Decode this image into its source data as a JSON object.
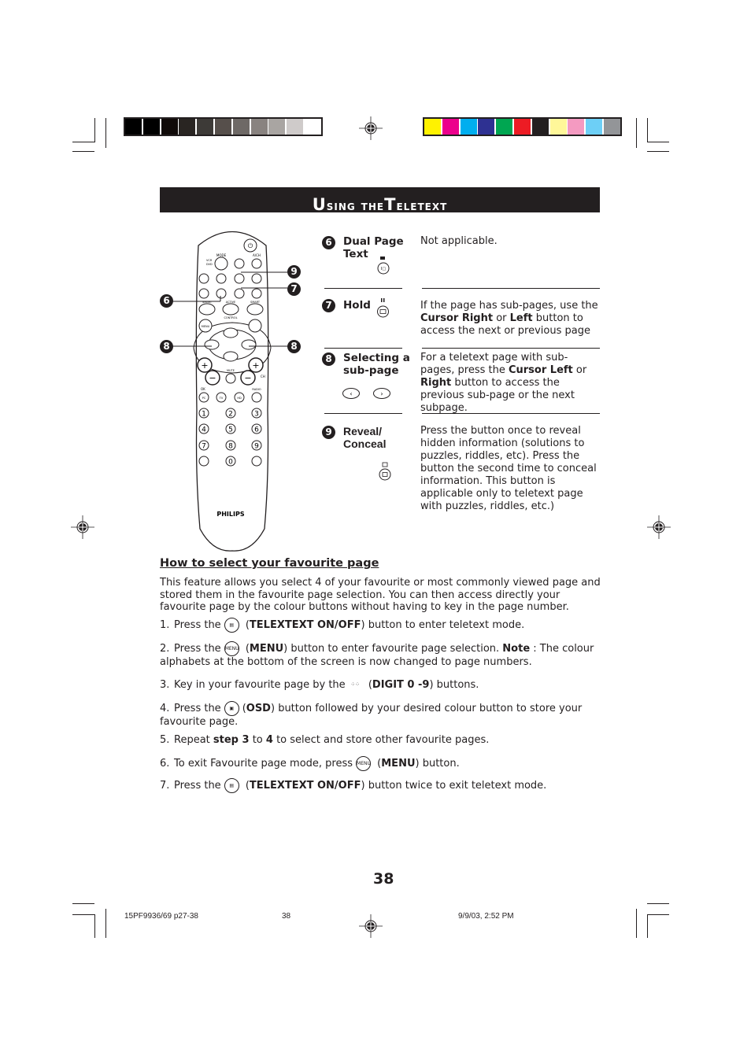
{
  "title": {
    "first_big": "U",
    "first_rest": "sing the ",
    "second_big": "T",
    "second_rest": "eletext"
  },
  "color_bars": {
    "grayscale": [
      "#000000",
      "#000000",
      "#100a08",
      "#292522",
      "#3d3a37",
      "#564f4b",
      "#6e6966",
      "#898380",
      "#a9a5a2",
      "#cfcbca",
      "#ffffff"
    ],
    "process": [
      "#fff200",
      "#ec008c",
      "#00aeef",
      "#2e3192",
      "#00a651",
      "#ed1c24",
      "#231f20",
      "#fff799",
      "#f49ac1",
      "#6dcff6",
      "#939598"
    ]
  },
  "remote": {
    "brand": "PHILIPS",
    "labels": {
      "mode": "MODE",
      "ach": "A/CH",
      "vcr": "VCR",
      "dvd": "DVD",
      "smart_left": "SMART",
      "active": "ACTIVE",
      "smart_right": "SMART",
      "control": "CONTROL",
      "menu": "MENU",
      "mute": "MUTE",
      "ch": "CH",
      "ok": "OK",
      "radio": "RADIO",
      "pc": "PC",
      "tv": "TV",
      "hd": "HD"
    },
    "digits": [
      "1",
      "2",
      "3",
      "4",
      "5",
      "6",
      "7",
      "8",
      "9",
      "0"
    ],
    "callouts": [
      "6",
      "7",
      "8",
      "9"
    ]
  },
  "features": [
    {
      "number": "6",
      "label_line1": "Dual Page",
      "label_line2": "Text",
      "description": "Not applicable.",
      "icon": "dual-page-icon"
    },
    {
      "number": "7",
      "label_line1": "Hold",
      "label_line2": "",
      "description_parts": [
        "If the page has sub-pages, use the ",
        "Cursor Right",
        " or ",
        "Left",
        " button to access the next or previous page"
      ],
      "icon": "hold-icon"
    },
    {
      "number": "8",
      "label_line1": "Selecting a",
      "label_line2": "sub-page",
      "description_parts": [
        "For a teletext page with sub-pages, press the ",
        "Cursor Left",
        " or ",
        "Right",
        " button to access the previous sub-page or the next subpage."
      ],
      "icon": "cursor-left-right-icon"
    },
    {
      "number": "9",
      "label_line1": "Reveal/",
      "label_line2": "Conceal",
      "description": "Press the button once to reveal hidden information (solutions to puzzles, riddles, etc). Press the button the second time to conceal information. This button is applicable only to teletext page with puzzles, riddles, etc.)",
      "icon": "reveal-icon"
    }
  ],
  "favourite": {
    "heading": "How to select your favourite page",
    "intro": "This feature allows you select 4 of your favourite or most commonly viewed page and stored them in the favourite page selection. You can then access directly your favourite page by the colour buttons without having to key in the page number.",
    "steps": [
      {
        "n": "1.",
        "pre": "Press the",
        "bold": "TELEXTEXT ON/OFF",
        "post": ") button to enter teletext mode.",
        "icon": "teletext-icon"
      },
      {
        "n": "2.",
        "pre": "Press the",
        "bold": "MENU",
        "post": ") button to enter favourite page selection. ",
        "note_label": "Note",
        "note": " : The colour alphabets at the bottom of the screen is now changed to page numbers.",
        "icon": "menu-icon"
      },
      {
        "n": "3.",
        "pre": "Key in your favourite page by the",
        "bold": "DIGIT 0 -9",
        "post": ") buttons.",
        "icon": "digit-keypad-icon"
      },
      {
        "n": "4.",
        "pre": "Press the",
        "bold": "OSD",
        "post": ") button followed by your desired colour button to store your favourite page.",
        "icon": "osd-icon"
      },
      {
        "n": "5.",
        "pre": "Repeat ",
        "bold1": "step 3",
        "mid": " to ",
        "bold2": "4",
        "post": " to select and store other favourite pages."
      },
      {
        "n": "6.",
        "pre": "To exit Favourite page mode, press",
        "bold": "MENU",
        "post": ") button.",
        "icon": "menu-icon"
      },
      {
        "n": "7.",
        "pre": "Press the",
        "bold": "TELEXTEXT ON/OFF",
        "post": ") button twice to exit teletext mode.",
        "icon": "teletext-icon"
      }
    ]
  },
  "page_number": "38",
  "footer": {
    "file": "15PF9936/69 p27-38",
    "page": "38",
    "timestamp": "9/9/03, 2:52 PM"
  }
}
